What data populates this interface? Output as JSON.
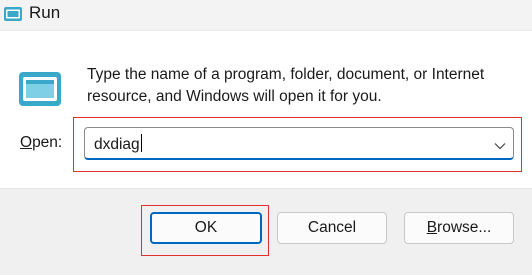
{
  "window": {
    "title": "Run",
    "title_icon": "run-dialog-icon"
  },
  "body": {
    "icon": "run-program-icon",
    "description": "Type the name of a program, folder, document, or Internet resource, and Windows will open it for you."
  },
  "open_field": {
    "label_prefix": "",
    "label_mnemonic": "O",
    "label_rest": "pen:",
    "value": "dxdiag",
    "dropdown_icon": "chevron-down-icon"
  },
  "buttons": {
    "ok": "OK",
    "cancel": "Cancel",
    "browse_mnemonic": "B",
    "browse_rest": "rowse..."
  },
  "colors": {
    "accent": "#0067c0",
    "highlight": "#e03030",
    "icon_teal": "#3aa9c9"
  }
}
